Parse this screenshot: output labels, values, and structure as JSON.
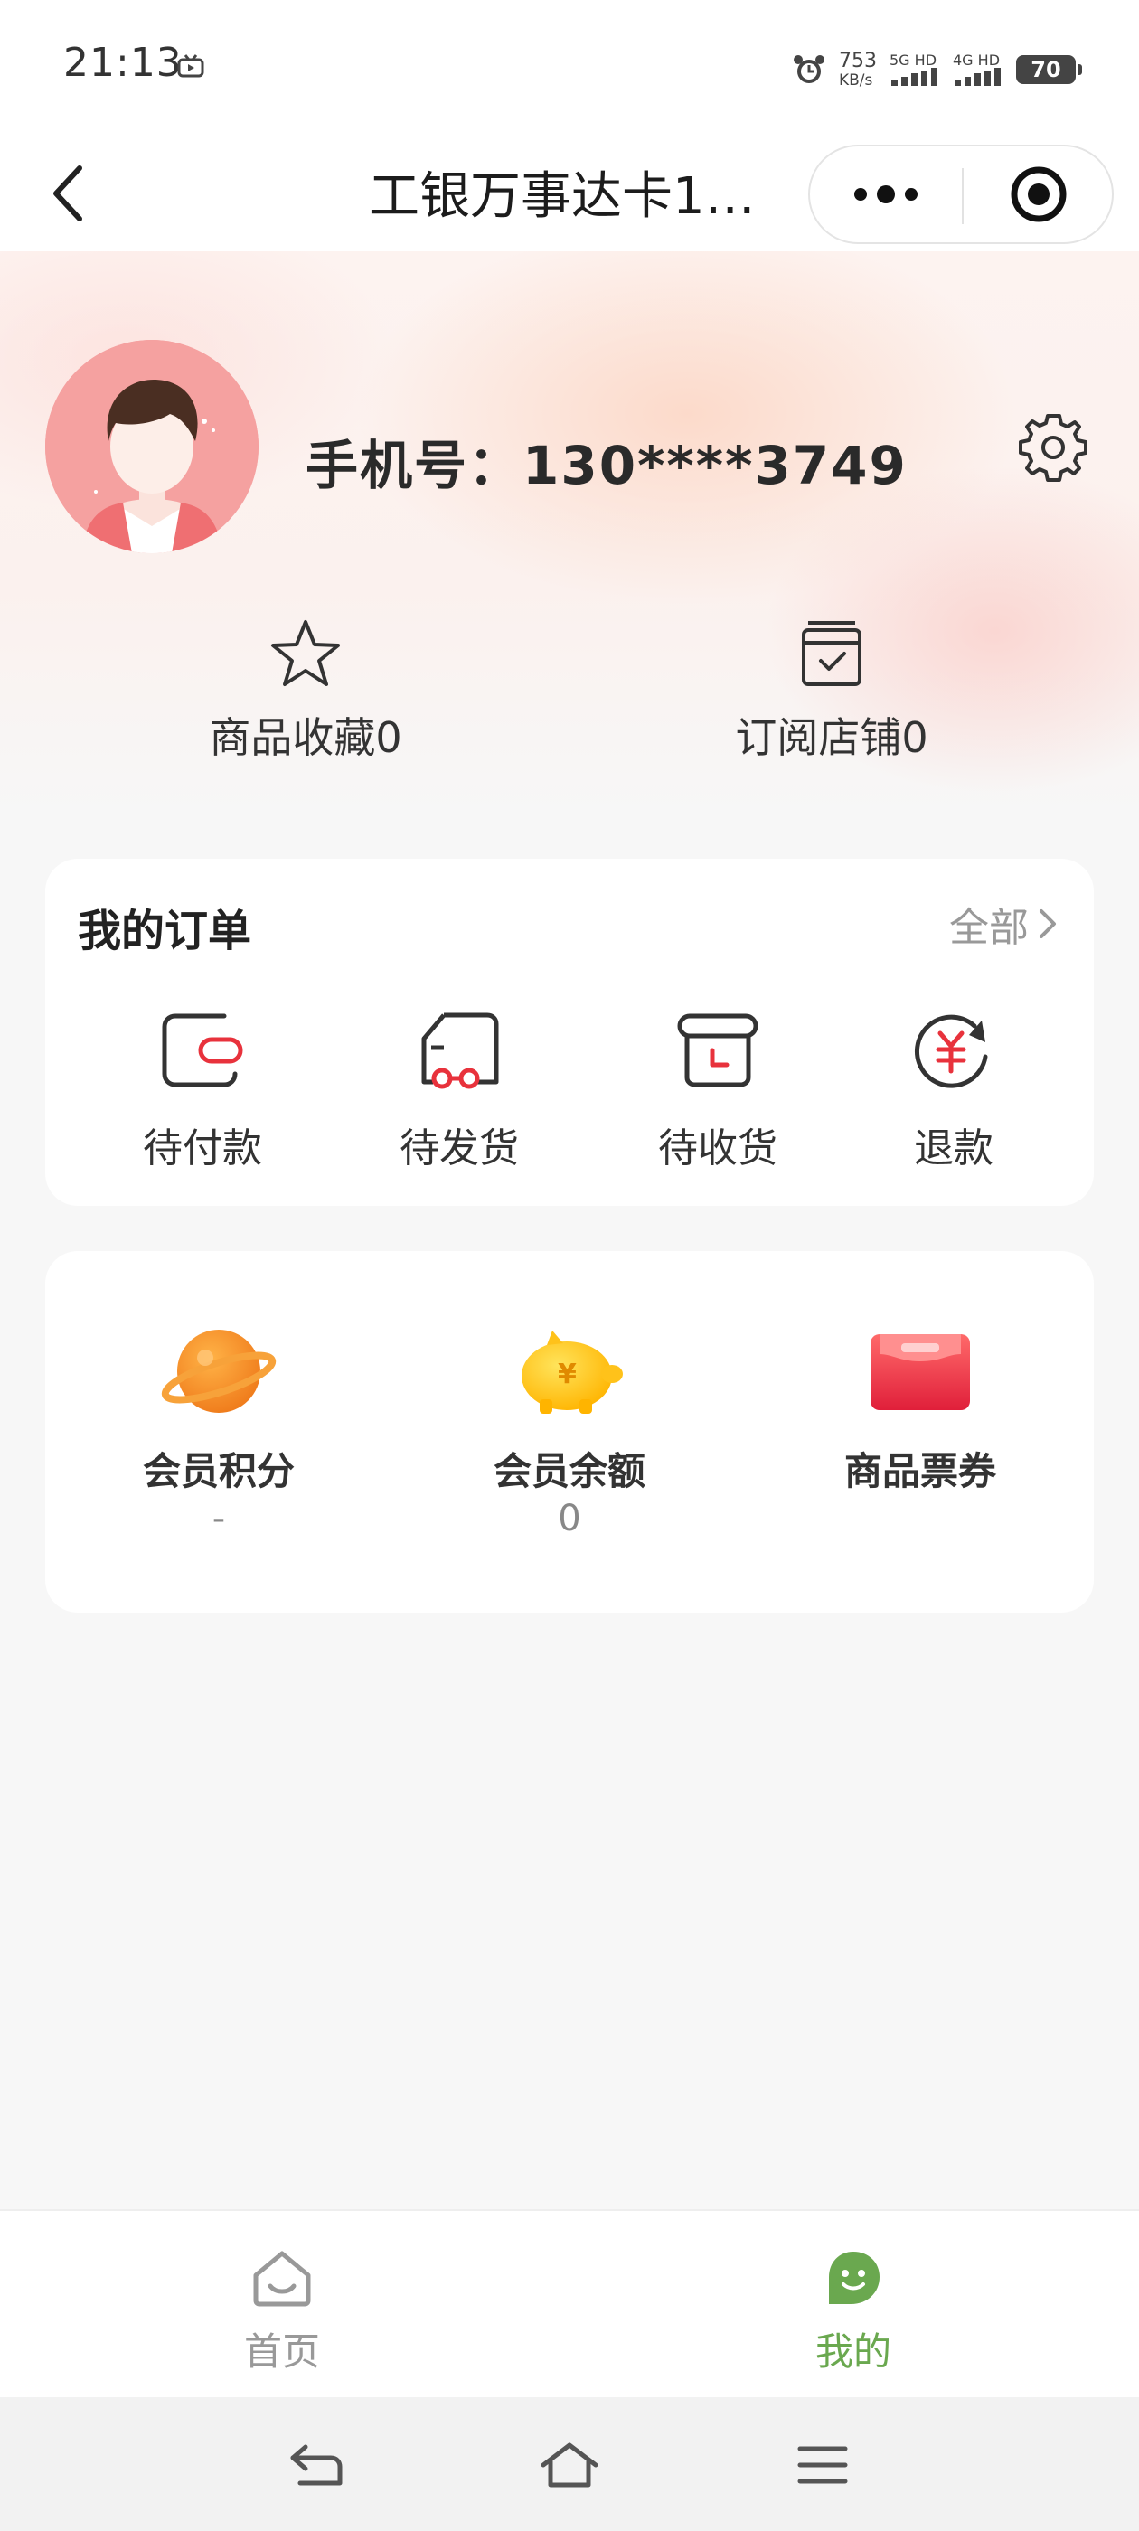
{
  "status_bar": {
    "time": "21:13",
    "net_speed": "753",
    "net_speed_unit": "KB/s",
    "sim1": "5G HD",
    "sim2": "4G HD",
    "battery": "70"
  },
  "title_bar": {
    "title": "工银万事达卡1…"
  },
  "profile": {
    "phone_label": "手机号：130****3749"
  },
  "favorites": {
    "goods_label": "商品收藏0",
    "shops_label": "订阅店铺0"
  },
  "orders": {
    "title": "我的订单",
    "all_label": "全部",
    "items": [
      {
        "label": "待付款",
        "icon": "wallet-icon"
      },
      {
        "label": "待发货",
        "icon": "truck-icon"
      },
      {
        "label": "待收货",
        "icon": "box-icon"
      },
      {
        "label": "退款",
        "icon": "refund-icon"
      }
    ]
  },
  "assets": {
    "items": [
      {
        "label": "会员积分",
        "value": "-",
        "icon": "planet-icon"
      },
      {
        "label": "会员余额",
        "value": "0",
        "icon": "piggy-bank-icon"
      },
      {
        "label": "商品票券",
        "value": "",
        "icon": "coupon-wallet-icon"
      }
    ]
  },
  "tabs": {
    "home_label": "首页",
    "mine_label": "我的"
  },
  "colors": {
    "accent_red": "#e8323c",
    "tab_active_green": "#6aa84f",
    "asset_orange": "#f08a24",
    "asset_yellow": "#ffcc2a",
    "asset_red": "#f0364a"
  }
}
